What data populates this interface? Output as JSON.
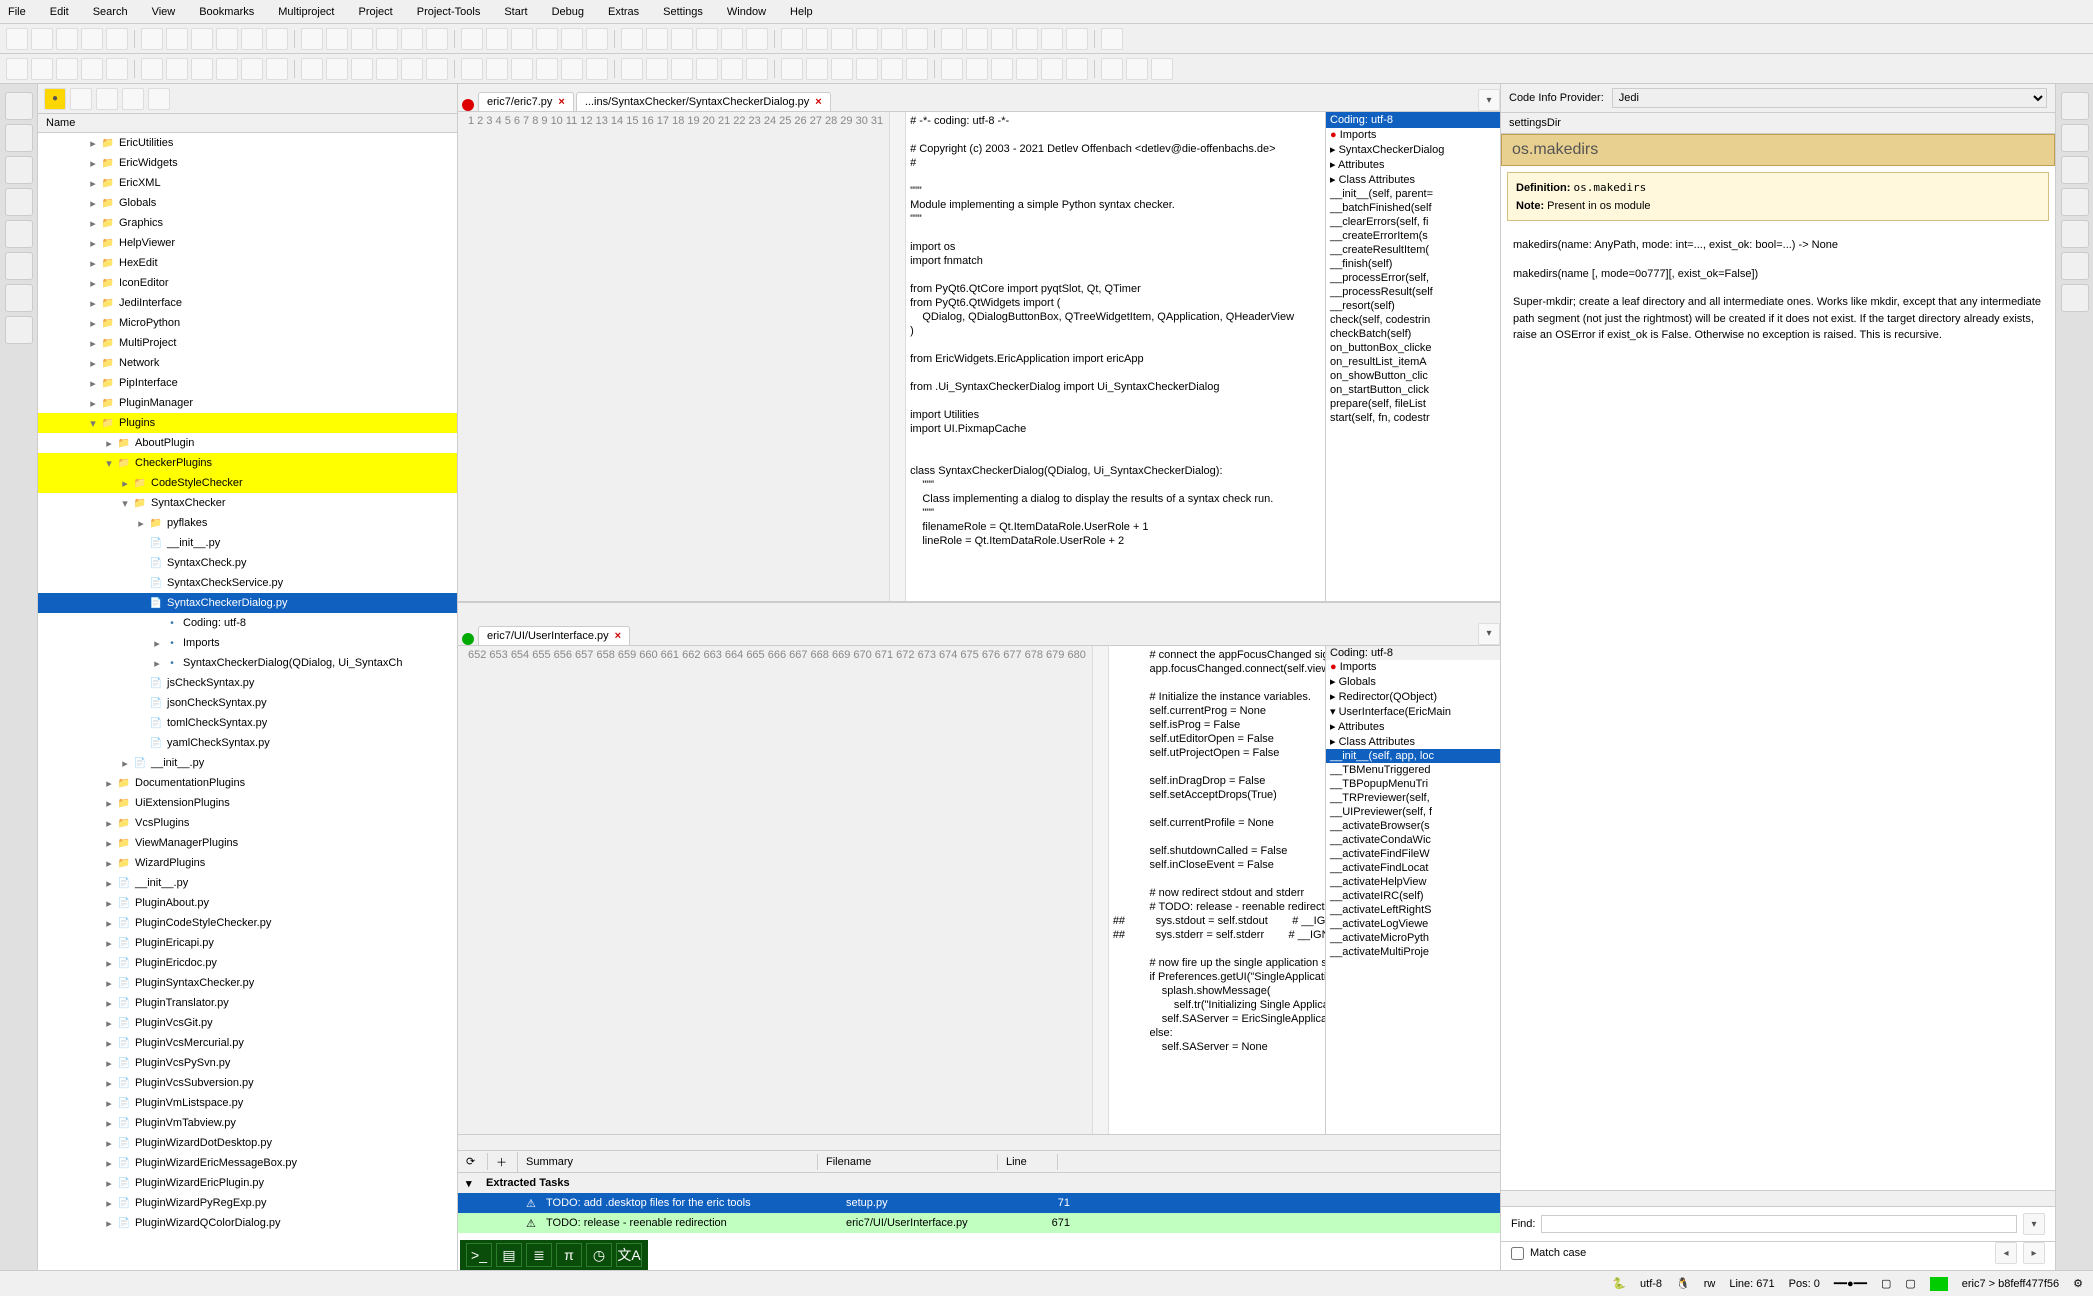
{
  "menu": [
    "File",
    "Edit",
    "Search",
    "View",
    "Bookmarks",
    "Multiproject",
    "Project",
    "Project-Tools",
    "Start",
    "Debug",
    "Extras",
    "Settings",
    "Window",
    "Help"
  ],
  "tree": {
    "column": "Name",
    "items": [
      {
        "d": 3,
        "l": "EricUtilities",
        "t": "folder",
        "e": "▸"
      },
      {
        "d": 3,
        "l": "EricWidgets",
        "t": "folder",
        "e": "▸"
      },
      {
        "d": 3,
        "l": "EricXML",
        "t": "folder",
        "e": "▸"
      },
      {
        "d": 3,
        "l": "Globals",
        "t": "folder",
        "e": "▸"
      },
      {
        "d": 3,
        "l": "Graphics",
        "t": "folder",
        "e": "▸"
      },
      {
        "d": 3,
        "l": "HelpViewer",
        "t": "folder",
        "e": "▸"
      },
      {
        "d": 3,
        "l": "HexEdit",
        "t": "folder",
        "e": "▸"
      },
      {
        "d": 3,
        "l": "IconEditor",
        "t": "folder",
        "e": "▸"
      },
      {
        "d": 3,
        "l": "JediInterface",
        "t": "folder",
        "e": "▸"
      },
      {
        "d": 3,
        "l": "MicroPython",
        "t": "folder",
        "e": "▸"
      },
      {
        "d": 3,
        "l": "MultiProject",
        "t": "folder",
        "e": "▸"
      },
      {
        "d": 3,
        "l": "Network",
        "t": "folder",
        "e": "▸"
      },
      {
        "d": 3,
        "l": "PipInterface",
        "t": "folder",
        "e": "▸"
      },
      {
        "d": 3,
        "l": "PluginManager",
        "t": "folder",
        "e": "▸"
      },
      {
        "d": 3,
        "l": "Plugins",
        "t": "folder",
        "e": "▾",
        "hl": "y"
      },
      {
        "d": 4,
        "l": "AboutPlugin",
        "t": "folder",
        "e": "▸"
      },
      {
        "d": 4,
        "l": "CheckerPlugins",
        "t": "folder",
        "e": "▾",
        "hl": "y"
      },
      {
        "d": 5,
        "l": "CodeStyleChecker",
        "t": "folder",
        "e": "▸",
        "hl": "y"
      },
      {
        "d": 5,
        "l": "SyntaxChecker",
        "t": "folder",
        "e": "▾"
      },
      {
        "d": 6,
        "l": "pyflakes",
        "t": "folder",
        "e": "▸"
      },
      {
        "d": 6,
        "l": "__init__.py",
        "t": "py"
      },
      {
        "d": 6,
        "l": "SyntaxCheck.py",
        "t": "py"
      },
      {
        "d": 6,
        "l": "SyntaxCheckService.py",
        "t": "py"
      },
      {
        "d": 6,
        "l": "SyntaxCheckerDialog.py",
        "t": "py",
        "hl": "b"
      },
      {
        "d": 7,
        "l": "Coding: utf-8",
        "t": "enc"
      },
      {
        "d": 7,
        "l": "Imports",
        "t": "imp",
        "e": "▸"
      },
      {
        "d": 7,
        "l": "SyntaxCheckerDialog(QDialog, Ui_SyntaxCh",
        "t": "cls",
        "e": "▸"
      },
      {
        "d": 6,
        "l": "jsCheckSyntax.py",
        "t": "py"
      },
      {
        "d": 6,
        "l": "jsonCheckSyntax.py",
        "t": "py"
      },
      {
        "d": 6,
        "l": "tomlCheckSyntax.py",
        "t": "py"
      },
      {
        "d": 6,
        "l": "yamlCheckSyntax.py",
        "t": "py"
      },
      {
        "d": 5,
        "l": "__init__.py",
        "t": "py",
        "e": "▸"
      },
      {
        "d": 4,
        "l": "DocumentationPlugins",
        "t": "folder",
        "e": "▸"
      },
      {
        "d": 4,
        "l": "UiExtensionPlugins",
        "t": "folder",
        "e": "▸"
      },
      {
        "d": 4,
        "l": "VcsPlugins",
        "t": "folder",
        "e": "▸"
      },
      {
        "d": 4,
        "l": "ViewManagerPlugins",
        "t": "folder",
        "e": "▸"
      },
      {
        "d": 4,
        "l": "WizardPlugins",
        "t": "folder",
        "e": "▸"
      },
      {
        "d": 4,
        "l": "__init__.py",
        "t": "py",
        "e": "▸"
      },
      {
        "d": 4,
        "l": "PluginAbout.py",
        "t": "py",
        "e": "▸"
      },
      {
        "d": 4,
        "l": "PluginCodeStyleChecker.py",
        "t": "py",
        "e": "▸"
      },
      {
        "d": 4,
        "l": "PluginEricapi.py",
        "t": "py",
        "e": "▸"
      },
      {
        "d": 4,
        "l": "PluginEricdoc.py",
        "t": "py",
        "e": "▸"
      },
      {
        "d": 4,
        "l": "PluginSyntaxChecker.py",
        "t": "py",
        "e": "▸"
      },
      {
        "d": 4,
        "l": "PluginTranslator.py",
        "t": "py",
        "e": "▸"
      },
      {
        "d": 4,
        "l": "PluginVcsGit.py",
        "t": "py",
        "e": "▸"
      },
      {
        "d": 4,
        "l": "PluginVcsMercurial.py",
        "t": "py",
        "e": "▸"
      },
      {
        "d": 4,
        "l": "PluginVcsPySvn.py",
        "t": "py",
        "e": "▸"
      },
      {
        "d": 4,
        "l": "PluginVcsSubversion.py",
        "t": "py",
        "e": "▸"
      },
      {
        "d": 4,
        "l": "PluginVmListspace.py",
        "t": "py",
        "e": "▸"
      },
      {
        "d": 4,
        "l": "PluginVmTabview.py",
        "t": "py",
        "e": "▸"
      },
      {
        "d": 4,
        "l": "PluginWizardDotDesktop.py",
        "t": "py",
        "e": "▸"
      },
      {
        "d": 4,
        "l": "PluginWizardEricMessageBox.py",
        "t": "py",
        "e": "▸"
      },
      {
        "d": 4,
        "l": "PluginWizardEricPlugin.py",
        "t": "py",
        "e": "▸"
      },
      {
        "d": 4,
        "l": "PluginWizardPyRegExp.py",
        "t": "py",
        "e": "▸"
      },
      {
        "d": 4,
        "l": "PluginWizardQColorDialog.py",
        "t": "py",
        "e": "▸"
      }
    ]
  },
  "editor1": {
    "tab1": "eric7/eric7.py",
    "tab2": "...ins/SyntaxChecker/SyntaxCheckerDialog.py",
    "encoding": "Coding: utf-8",
    "lines_start": 1,
    "outline": [
      {
        "l": "Imports",
        "i": "●",
        "c": "#d00"
      },
      {
        "l": "SyntaxCheckerDialog",
        "i": "▸"
      },
      {
        "l": "Attributes",
        "i": "▸"
      },
      {
        "l": "Class Attributes",
        "i": "▸"
      },
      {
        "l": "__init__(self, parent=",
        "i": ""
      },
      {
        "l": "__batchFinished(self",
        "i": ""
      },
      {
        "l": "__clearErrors(self, fi",
        "i": ""
      },
      {
        "l": "__createErrorItem(s",
        "i": ""
      },
      {
        "l": "__createResultItem(",
        "i": ""
      },
      {
        "l": "__finish(self)",
        "i": ""
      },
      {
        "l": "__processError(self,",
        "i": ""
      },
      {
        "l": "__processResult(self",
        "i": ""
      },
      {
        "l": "__resort(self)",
        "i": ""
      },
      {
        "l": "check(self, codestrin",
        "i": ""
      },
      {
        "l": "checkBatch(self)",
        "i": ""
      },
      {
        "l": "on_buttonBox_clicke",
        "i": ""
      },
      {
        "l": "on_resultList_itemA",
        "i": ""
      },
      {
        "l": "on_showButton_clic",
        "i": ""
      },
      {
        "l": "on_startButton_click",
        "i": ""
      },
      {
        "l": "prepare(self, fileList",
        "i": ""
      },
      {
        "l": "start(self, fn, codestr",
        "i": ""
      }
    ]
  },
  "editor2": {
    "tab1": "eric7/UI/UserInterface.py",
    "encoding": "Coding: utf-8",
    "lines_start": 652,
    "outline": [
      {
        "l": "Imports",
        "i": "●",
        "c": "#d00"
      },
      {
        "l": "Globals",
        "i": "▸"
      },
      {
        "l": "Redirector(QObject)",
        "i": "▸"
      },
      {
        "l": "UserInterface(EricMain",
        "i": "▾"
      },
      {
        "l": "Attributes",
        "i": "▸"
      },
      {
        "l": "Class Attributes",
        "i": "▸"
      },
      {
        "l": "__init__(self, app, loc",
        "i": "",
        "sel": true
      },
      {
        "l": "__TBMenuTriggered",
        "i": ""
      },
      {
        "l": "__TBPopupMenuTri",
        "i": ""
      },
      {
        "l": "__TRPreviewer(self,",
        "i": ""
      },
      {
        "l": "__UIPreviewer(self, f",
        "i": ""
      },
      {
        "l": "__activateBrowser(s",
        "i": ""
      },
      {
        "l": "__activateCondaWic",
        "i": ""
      },
      {
        "l": "__activateFindFileW",
        "i": ""
      },
      {
        "l": "__activateFindLocat",
        "i": ""
      },
      {
        "l": "__activateHelpView",
        "i": ""
      },
      {
        "l": "__activateIRC(self)",
        "i": ""
      },
      {
        "l": "__activateLeftRightS",
        "i": ""
      },
      {
        "l": "__activateLogViewe",
        "i": ""
      },
      {
        "l": "__activateMicroPyth",
        "i": ""
      },
      {
        "l": "__activateMultiProje",
        "i": ""
      }
    ]
  },
  "code1": "# -*- coding: utf-8 -*-\n\n# Copyright (c) 2003 - 2021 Detlev Offenbach <detlev@die-offenbachs.de>\n#\n\n\"\"\"\nModule implementing a simple Python syntax checker.\n\"\"\"\n\nimport os\nimport fnmatch\n\nfrom PyQt6.QtCore import pyqtSlot, Qt, QTimer\nfrom PyQt6.QtWidgets import (\n    QDialog, QDialogButtonBox, QTreeWidgetItem, QApplication, QHeaderView\n)\n\nfrom EricWidgets.EricApplication import ericApp\n\nfrom .Ui_SyntaxCheckerDialog import Ui_SyntaxCheckerDialog\n\nimport Utilities\nimport UI.PixmapCache\n\n\nclass SyntaxCheckerDialog(QDialog, Ui_SyntaxCheckerDialog):\n    \"\"\"\n    Class implementing a dialog to display the results of a syntax check run.\n    \"\"\"\n    filenameRole = Qt.ItemDataRole.UserRole + 1\n    lineRole = Qt.ItemDataRole.UserRole + 2",
  "code2": "            # connect the appFocusChanged signal after all actions are ready\n            app.focusChanged.connect(self.viewmanager.appFocusChanged)\n            \n            # Initialize the instance variables.\n            self.currentProg = None\n            self.isProg = False\n            self.utEditorOpen = False\n            self.utProjectOpen = False\n            \n            self.inDragDrop = False\n            self.setAcceptDrops(True)\n            \n            self.currentProfile = None\n            \n            self.shutdownCalled = False\n            self.inCloseEvent = False\n            \n            # now redirect stdout and stderr\n            # TODO: release - reenable redirection\n##          sys.stdout = self.stdout        # __IGNORE_WARNING_M891__\n##          sys.stderr = self.stderr        # __IGNORE_WARNING_M891__\n            \n            # now fire up the single application server\n            if Preferences.getUI(\"SingleApplicationMode\"):\n                splash.showMessage(\n                    self.tr(\"Initializing Single Application Server...\"))\n                self.SAServer = EricSingleApplicationServer()\n            else:\n                self.SAServer = None",
  "tasks": {
    "cols": [
      "Summary",
      "Filename",
      "Line"
    ],
    "group": "Extracted Tasks",
    "rows": [
      {
        "s": "TODO: add .desktop files for the eric tools",
        "f": "setup.py",
        "ln": "71",
        "c": "blue"
      },
      {
        "s": "TODO: release - reenable redirection",
        "f": "eric7/UI/UserInterface.py",
        "ln": "671",
        "c": "green"
      }
    ]
  },
  "info": {
    "provider_label": "Code Info Provider:",
    "provider": "Jedi",
    "crumb": "settingsDir",
    "title": "os.makedirs",
    "def_label": "Definition:",
    "def_val": "os.makedirs",
    "note_label": "Note:",
    "note_val": "Present in os module",
    "sig1": "makedirs(name: AnyPath, mode: int=..., exist_ok: bool=...) -> None",
    "sig2": "makedirs(name [, mode=0o777][, exist_ok=False])",
    "desc": "Super-mkdir; create a leaf directory and all intermediate ones. Works like mkdir, except that any intermediate path segment (not just the rightmost) will be created if it does not exist. If the target directory already exists, raise an OSError if exist_ok is False. Otherwise no exception is raised. This is recursive.",
    "find_label": "Find:",
    "match_case": "Match case"
  },
  "status": {
    "enc": "utf-8",
    "rw": "rw",
    "line": "Line: 671",
    "pos": "Pos: 0",
    "path": "eric7 > b8feff477f56"
  }
}
